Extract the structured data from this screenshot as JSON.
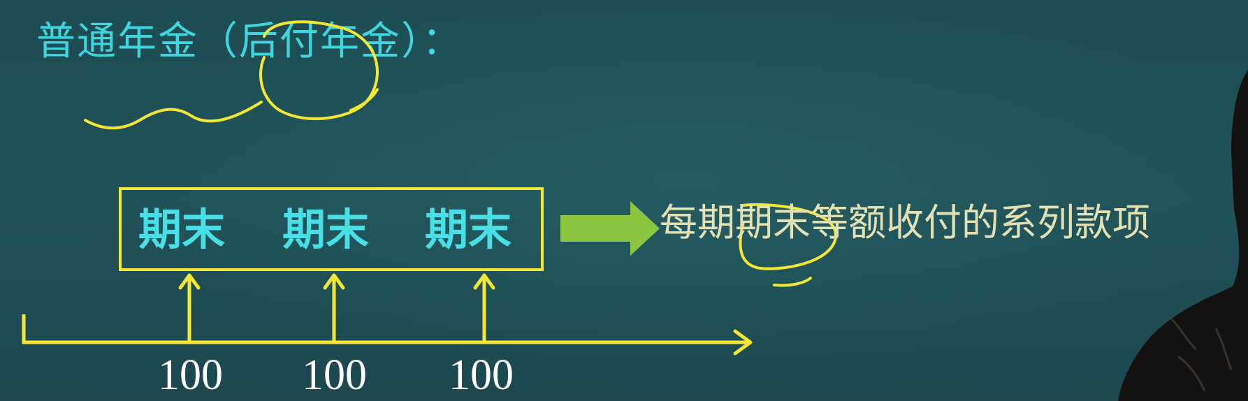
{
  "title": "普通年金（后付年金）：",
  "periods": [
    "期末",
    "期末",
    "期末"
  ],
  "description": "每期期末等额收付的系列款项",
  "amounts": [
    "100",
    "100",
    "100"
  ],
  "colors": {
    "background": "#1f5056",
    "title": "#3fd6e0",
    "period_text": "#46e0e6",
    "box_and_axis": "#f2e734",
    "arrow": "#8cc63f",
    "description": "#e3e1b4",
    "amount_text": "#ffffff",
    "annotation": "#f2e734"
  }
}
